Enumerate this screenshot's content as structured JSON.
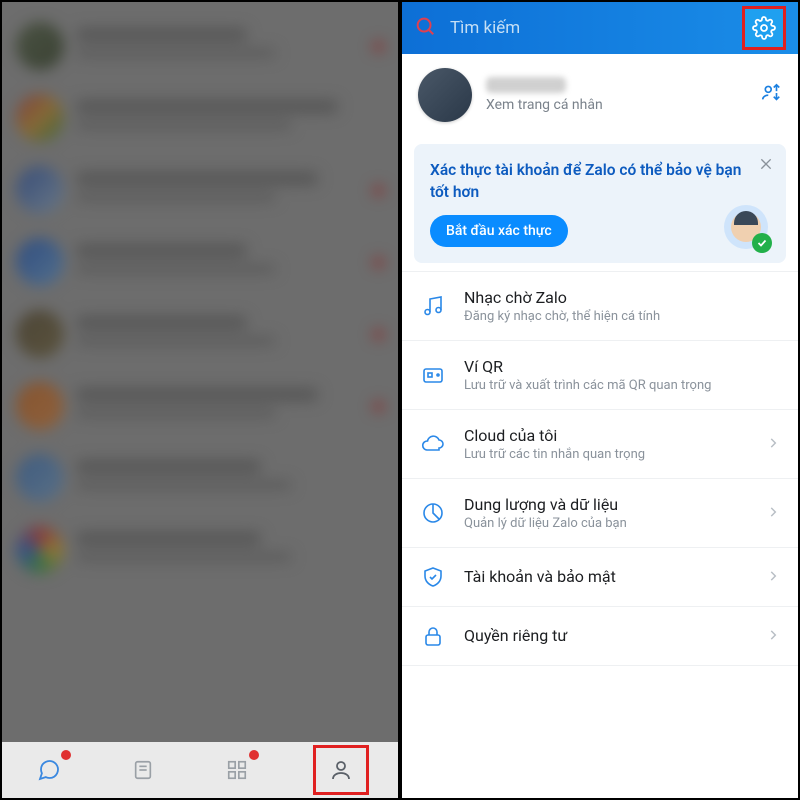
{
  "search_placeholder": "Tìm kiếm",
  "profile": {
    "subtitle": "Xem trang cá nhân"
  },
  "verify": {
    "title": "Xác thực tài khoản để Zalo có thể bảo vệ bạn tốt hơn",
    "button": "Bắt đầu xác thực"
  },
  "menu": [
    {
      "title": "Nhạc chờ Zalo",
      "sub": "Đăng ký nhạc chờ, thể hiện cá tính",
      "chevron": false
    },
    {
      "title": "Ví QR",
      "sub": "Lưu trữ và xuất trình các mã QR quan trọng",
      "chevron": false
    },
    {
      "title": "Cloud của tôi",
      "sub": "Lưu trữ các tin nhắn quan trọng",
      "chevron": true
    },
    {
      "title": "Dung lượng và dữ liệu",
      "sub": "Quản lý dữ liệu Zalo của bạn",
      "chevron": true
    },
    {
      "title": "Tài khoản và bảo mật",
      "sub": "",
      "chevron": true
    },
    {
      "title": "Quyền riêng tư",
      "sub": "",
      "chevron": true
    }
  ]
}
